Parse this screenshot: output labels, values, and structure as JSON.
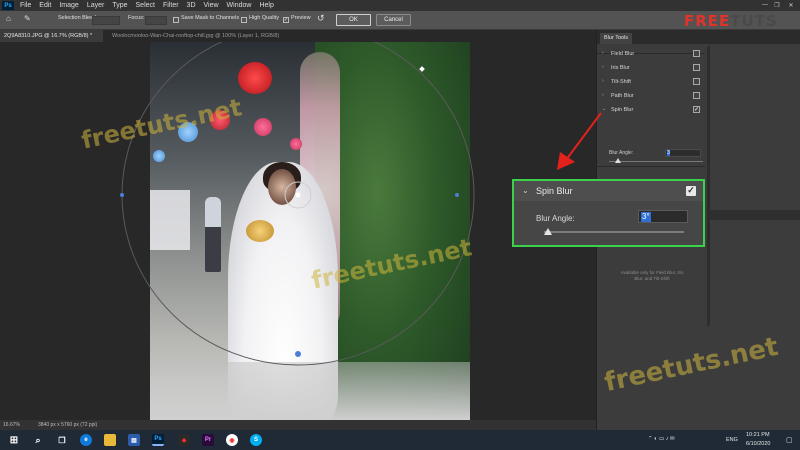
{
  "app": {
    "logo_text": "Ps"
  },
  "menu": [
    "File",
    "Edit",
    "Image",
    "Layer",
    "Type",
    "Select",
    "Filter",
    "3D",
    "View",
    "Window",
    "Help"
  ],
  "options": {
    "selection_bleed_label": "Selection Bleed:",
    "focus_label": "Focus:",
    "save_mask_label": "Save Mask to Channels",
    "high_quality_label": "High Quality",
    "preview_label": "Preview",
    "preview_checked": true,
    "ok_label": "OK",
    "cancel_label": "Cancel"
  },
  "tabs": [
    {
      "label": "2Q9A8310.JPG @ 16.7% (RGB/8) *",
      "active": true
    },
    {
      "label": "Woolocmooloo-Wan-Chai-rooftop-chill.jpg @ 100% (Layer 1, RGB/8)",
      "active": false
    }
  ],
  "panel": {
    "tab_label": "Blur Tools",
    "items": [
      {
        "label": "Field Blur",
        "checked": false
      },
      {
        "label": "Iris Blur",
        "checked": false
      },
      {
        "label": "Tilt-Shift",
        "checked": false
      },
      {
        "label": "Path Blur",
        "checked": false
      },
      {
        "label": "Spin Blur",
        "checked": true
      }
    ],
    "blur_angle_label": "Blur Angle:",
    "blur_angle_value": "3",
    "availability_note": "Available only for Field Blur, Iris Blur, and Tilt-Shift"
  },
  "callout": {
    "title": "Spin Blur",
    "checked": true,
    "angle_label": "Blur Angle:",
    "angle_value": "3°",
    "slider_fraction": 0.03
  },
  "status": {
    "zoom": "16.67%",
    "doc_size": "3840 px x 5760 px (72 ppi)"
  },
  "watermarks": [
    "freetuts.net",
    "freetuts.net",
    "freetuts.net"
  ],
  "brand": {
    "logo_part1": "FREE",
    "logo_part2": "TUTS"
  },
  "taskbar": {
    "language": "ENG",
    "time": "10:21 PM",
    "date": "6/10/2020"
  },
  "colors": {
    "highlight_green": "#3bd24b",
    "arrow_red": "#e3221b",
    "selection_blue": "#2f6fd8"
  }
}
